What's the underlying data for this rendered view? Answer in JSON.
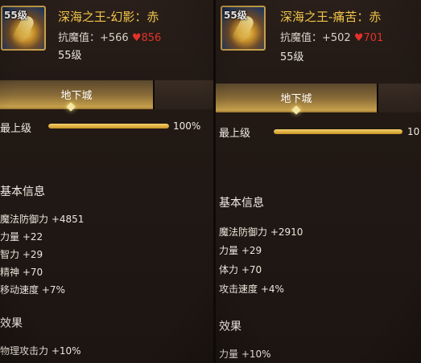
{
  "left": {
    "icon_level": "55级",
    "title": "深海之王-幻影：赤",
    "resist_label": "抗魔值：+566",
    "resist_red": "♥856",
    "level": "55级",
    "tab": "地下城",
    "max_label": "最上级",
    "progress": 1.0,
    "progress_text": "100%",
    "basic_title": "基本信息",
    "attributes": [
      "魔法防御力 +4851",
      "力量 +22",
      "智力 +29",
      "精神 +70",
      "移动速度 +7%"
    ],
    "effect_title": "效果",
    "effects": [
      "物理攻击力 +10%"
    ]
  },
  "right": {
    "icon_level": "55级",
    "title": "深海之王-痛苦：赤",
    "resist_label": "抗魔值：+502",
    "resist_red": "♥701",
    "level": "55级",
    "tab": "地下城",
    "max_label": "最上级",
    "progress": 1.0,
    "progress_text": "10",
    "basic_title": "基本信息",
    "attributes": [
      "魔法防御力 +2910",
      "力量 +29",
      "体力 +70",
      "攻击速度 +4%"
    ],
    "effect_title": "效果",
    "effects": [
      "力量 +10%"
    ]
  },
  "colors": {
    "gold": "#f1c64a",
    "red": "#e2322a",
    "bar": "#e0ad3e"
  }
}
